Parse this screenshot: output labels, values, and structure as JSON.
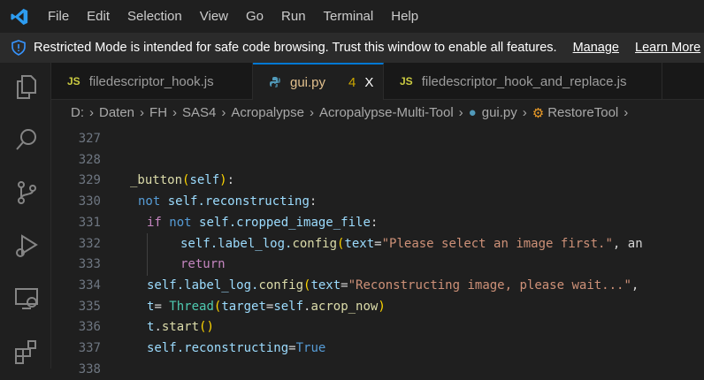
{
  "menu": [
    "File",
    "Edit",
    "Selection",
    "View",
    "Go",
    "Run",
    "Terminal",
    "Help"
  ],
  "banner": {
    "text": "Restricted Mode is intended for safe code browsing. Trust this window to enable all features.",
    "manage": "Manage",
    "learn_more": "Learn More"
  },
  "tabs": [
    {
      "label": "filedescriptor_hook.js",
      "icon": "JS"
    },
    {
      "label": "gui.py",
      "badge": "4",
      "close": "X"
    },
    {
      "label": "filedescriptor_hook_and_replace.js",
      "icon": "JS"
    }
  ],
  "breadcrumb": [
    "D:",
    "Daten",
    "FH",
    "SAS4",
    "Acropalypse",
    "Acropalypse-Multi-Tool",
    "gui.py",
    "RestoreTool"
  ],
  "colors": {
    "accent": "#0078d4",
    "string": "#ce9178",
    "keyword": "#569cd6",
    "variable": "#9cdcfe"
  },
  "lines": [
    {
      "n": "327",
      "indent": 0,
      "tokens": []
    },
    {
      "n": "328",
      "indent": 0,
      "tokens": []
    },
    {
      "n": "329",
      "indent": 0,
      "tokens": [
        [
          "_button",
          "fn"
        ],
        [
          "(",
          "br"
        ],
        [
          "self",
          "self"
        ],
        [
          ")",
          "br"
        ],
        [
          ":",
          "op"
        ]
      ]
    },
    {
      "n": "330",
      "indent": 1,
      "tokens": [
        [
          "not ",
          "kw"
        ],
        [
          "self",
          "self"
        ],
        [
          ".reconstructing",
          "self"
        ],
        [
          ":",
          "op"
        ]
      ]
    },
    {
      "n": "331",
      "indent": 2,
      "tokens": [
        [
          "if ",
          "ctl"
        ],
        [
          "not ",
          "kw"
        ],
        [
          "self",
          "self"
        ],
        [
          ".cropped_image_file",
          "self"
        ],
        [
          ":",
          "op"
        ]
      ]
    },
    {
      "n": "332",
      "indent": 3,
      "tokens": [
        [
          "self",
          "self"
        ],
        [
          ".label_log.",
          "self"
        ],
        [
          "config",
          "fn"
        ],
        [
          "(",
          "br"
        ],
        [
          "text",
          "self"
        ],
        [
          "=",
          "op"
        ],
        [
          "\"Please select an image first.\"",
          "str"
        ],
        [
          ", an",
          "op"
        ]
      ]
    },
    {
      "n": "333",
      "indent": 3,
      "tokens": [
        [
          "return",
          "ctl"
        ]
      ]
    },
    {
      "n": "334",
      "indent": 2,
      "tokens": [
        [
          "self",
          "self"
        ],
        [
          ".label_log.",
          "self"
        ],
        [
          "config",
          "fn"
        ],
        [
          "(",
          "br"
        ],
        [
          "text",
          "self"
        ],
        [
          "=",
          "op"
        ],
        [
          "\"Reconstructing image, please wait...\"",
          "str"
        ],
        [
          ",",
          "op"
        ]
      ]
    },
    {
      "n": "335",
      "indent": 2,
      "tokens": [
        [
          "t",
          "self"
        ],
        [
          "= ",
          "op"
        ],
        [
          "Thread",
          "cls"
        ],
        [
          "(",
          "br"
        ],
        [
          "target",
          "self"
        ],
        [
          "=",
          "op"
        ],
        [
          "self",
          "self"
        ],
        [
          ".",
          "op"
        ],
        [
          "acrop_now",
          "fn"
        ],
        [
          ")",
          "br"
        ]
      ]
    },
    {
      "n": "336",
      "indent": 2,
      "tokens": [
        [
          "t",
          "self"
        ],
        [
          ".",
          "op"
        ],
        [
          "start",
          "fn"
        ],
        [
          "()",
          "br"
        ]
      ]
    },
    {
      "n": "337",
      "indent": 2,
      "tokens": [
        [
          "self",
          "self"
        ],
        [
          ".reconstructing",
          "self"
        ],
        [
          "=",
          "op"
        ],
        [
          "True",
          "kw"
        ]
      ]
    },
    {
      "n": "338",
      "indent": 0,
      "tokens": []
    }
  ]
}
